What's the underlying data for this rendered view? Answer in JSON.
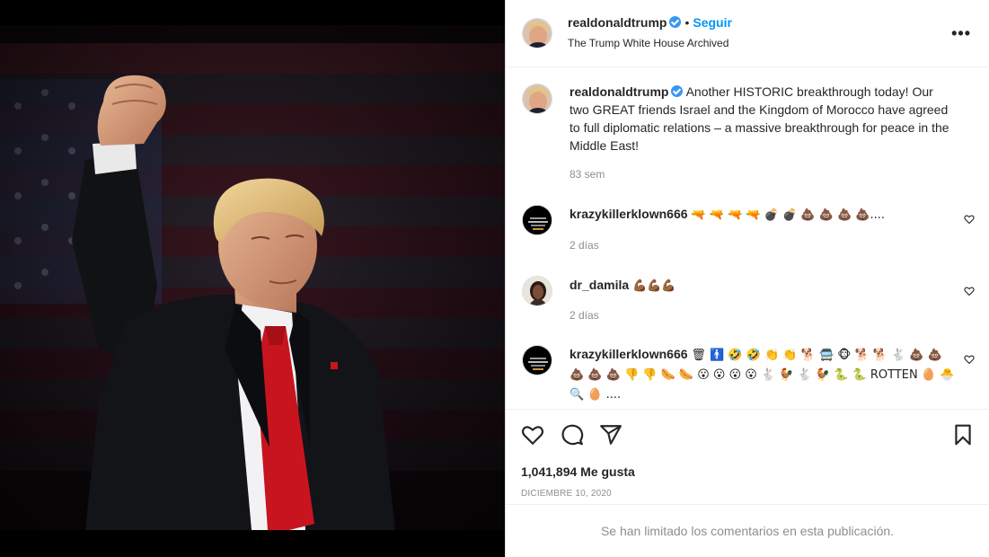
{
  "post": {
    "author": "realdonaldtrump",
    "follow_label": "Seguir",
    "dot": "•",
    "subtitle": "The Trump White House Archived",
    "more_label": "•••",
    "caption_text": "Another HISTORIC breakthrough today! Our two GREAT friends Israel and the Kingdom of Morocco have agreed to full diplomatic relations – a massive breakthrough for peace in the Middle East!",
    "caption_age": "83 sem",
    "likes": "1,041,894 Me gusta",
    "date": "DICIEMBRE 10, 2020",
    "limited_notice": "Se han limitado los comentarios en esta publicación."
  },
  "comments": [
    {
      "username": "krazykillerklown666",
      "text": "🔫 🔫 🔫 🔫 💣 💣 💩 💩 💩 💩....",
      "age": "2 días"
    },
    {
      "username": "dr_damila",
      "text": "💪🏾💪🏾💪🏾",
      "age": "2 días"
    },
    {
      "username": "krazykillerklown666",
      "text": "🗑 🚹 🤣 🤣 👏 👏 🐕 🚍 🐵 🐕 🐕 🐇 💩 💩 💩 💩 💩 👎 👎 🌭 🌭 😮 😮 😮 😮 🐇 🐓 🐇 🐓 🐍 🐍 ROTTEN 🥚 🐣 🔍 🥚 ....",
      "age": ""
    }
  ],
  "icons": {
    "heart": "heart-icon",
    "comment": "comment-icon",
    "share": "share-icon",
    "save": "bookmark-icon",
    "verified": "verified-badge-icon"
  },
  "colors": {
    "accent": "#0095f6",
    "verified": "#3897f0",
    "muted": "#8e8e8e"
  }
}
